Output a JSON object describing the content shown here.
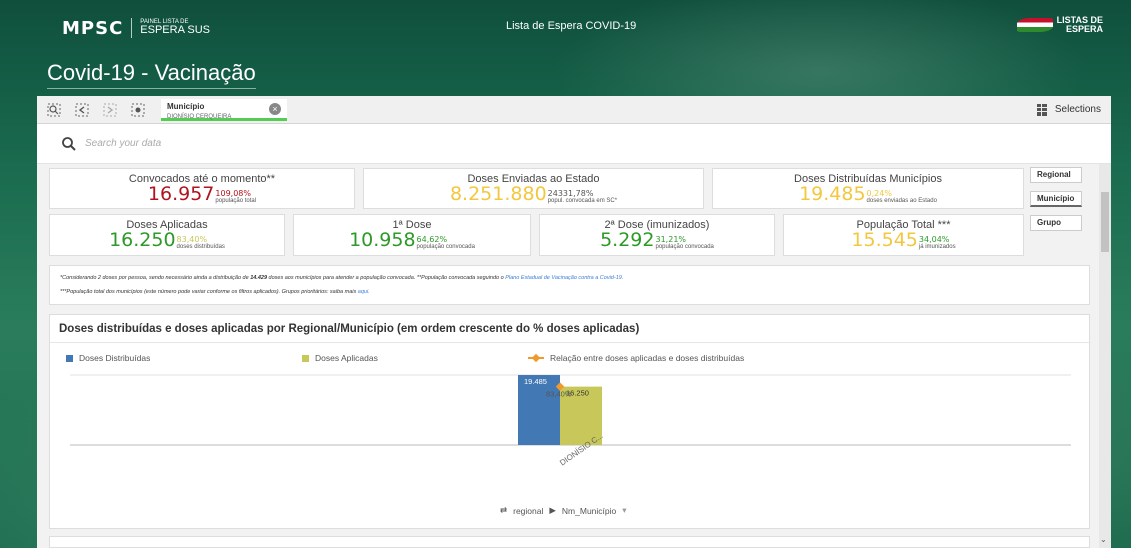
{
  "header": {
    "logo": "MPSC",
    "logo_sub1": "PAINEL LISTA DE",
    "logo_sub2": "ESPERA SUS",
    "center_title": "Lista de Espera   COVID-19",
    "right_logo_line1": "LISTAS DE",
    "right_logo_line2": "ESPERA"
  },
  "page_title": "Covid-19 - Vacinação",
  "toolbar": {
    "selection_field": "Município",
    "selection_value": "DIONÍSIO CERQUEIRA",
    "selections_label": "Selections"
  },
  "search": {
    "placeholder": "Search your data"
  },
  "kpis": {
    "convocados": {
      "label": "Convocados até o momento**",
      "value": "16.957",
      "pct": "109,08%",
      "sub": "população total"
    },
    "enviadas": {
      "label": "Doses Enviadas ao Estado",
      "value": "8.251.880",
      "pct": "24331,78%",
      "sub": "popul. convocada em SC*"
    },
    "distribuidas": {
      "label": "Doses Distribuídas Municípios",
      "value": "19.485",
      "pct": "0,24%",
      "sub": "doses enviadas ao Estado"
    },
    "aplicadas": {
      "label": "Doses Aplicadas",
      "value": "16.250",
      "pct": "83,40%",
      "sub": "doses distribuídas"
    },
    "dose1": {
      "label": "1ª Dose",
      "value": "10.958",
      "pct": "64,62%",
      "sub": "população convocada"
    },
    "dose2": {
      "label": "2ª Dose (imunizados)",
      "value": "5.292",
      "pct": "31,21%",
      "sub": "população convocada"
    },
    "populacao": {
      "label": "População Total ***",
      "value": "15.545",
      "pct": "34,04%",
      "sub": "já imunizados"
    }
  },
  "side_buttons": [
    "Regional",
    "Município",
    "Grupo"
  ],
  "footnote": {
    "line1_a": "*Considerando 2 doses por pessoa, sendo necessário ainda a distribuição de ",
    "line1_bold": "14.429",
    "line1_b": " doses aos municípios para atender a população convocada. **População convocada seguindo o ",
    "line1_link": "Plano Estadual de Vacinação contra a Covid-19.",
    "line2_a": "***População total dos municípios (este número pode variar conforme os filtros aplicados). Grupos prioritários: saiba mais ",
    "line2_link": "aqui."
  },
  "chart_data": {
    "type": "bar",
    "title": "Doses distribuídas e doses aplicadas por Regional/Município (em ordem crescente do % doses aplicadas)",
    "categories": [
      "DIONÍSIO C..."
    ],
    "series": [
      {
        "name": "Doses Distribuídas",
        "values": [
          19485
        ],
        "color": "#4278b4",
        "label": "19.485"
      },
      {
        "name": "Doses Aplicadas",
        "values": [
          16250
        ],
        "color": "#c8c85a",
        "label": "16.250"
      }
    ],
    "line_series": {
      "name": "Relação entre doses aplicadas e doses distribuídas",
      "values": [
        83.4
      ],
      "label": "83,40%",
      "color": "#f2992e"
    },
    "ylim": [
      0,
      19485
    ],
    "dimension_nav": {
      "level1": "regional",
      "level2": "Nm_Município"
    }
  }
}
